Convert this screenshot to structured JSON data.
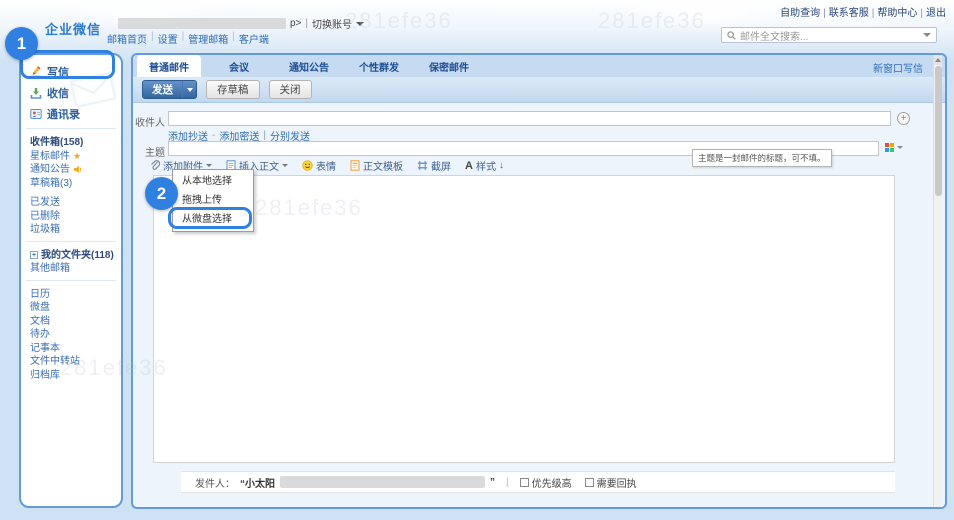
{
  "page": {
    "watermark": "281efe36"
  },
  "header": {
    "quick_links": [
      "自助查询",
      "联系客服",
      "帮助中心",
      "退出"
    ],
    "logo": "企业微信",
    "account": {
      "masked_suffix": "p>",
      "switch_label": "切换账号"
    },
    "nav_links": [
      "邮箱首页",
      "设置",
      "管理邮箱",
      "客户端"
    ],
    "search": {
      "placeholder": "邮件全文搜索..."
    }
  },
  "sidebar": {
    "actions": [
      {
        "label": "写信"
      },
      {
        "label": "收信"
      },
      {
        "label": "通讯录"
      }
    ],
    "folders": [
      {
        "label": "收件箱(158)"
      },
      {
        "label": "星标邮件"
      },
      {
        "label": "通知公告"
      },
      {
        "label": "草稿箱(3)"
      },
      {
        "label": "已发送"
      },
      {
        "label": "已删除"
      },
      {
        "label": "垃圾箱"
      }
    ],
    "my_folders": "我的文件夹(118)",
    "other_mailbox": "其他邮箱",
    "apps": [
      "日历",
      "微盘",
      "文档",
      "待办",
      "记事本",
      "文件中转站",
      "归档库"
    ]
  },
  "compose": {
    "new_window_link": "新窗口写信",
    "tabs": [
      {
        "label": "普通邮件"
      },
      {
        "label": "会议"
      },
      {
        "label": "通知公告"
      },
      {
        "label": "个性群发"
      },
      {
        "label": "保密邮件"
      }
    ],
    "actions": {
      "send": "发送",
      "save_draft": "存草稿",
      "close": "关闭"
    },
    "recipient": {
      "label": "收件人",
      "value": ""
    },
    "cc_row": {
      "add_cc": "添加抄送",
      "dash": "-",
      "add_bcc": "添加密送",
      "pipe": "|",
      "separate": "分别发送"
    },
    "subject": {
      "label": "主题",
      "value": "",
      "tooltip": "主题是一封邮件的标题，可不填。"
    },
    "editor_toolbar": [
      {
        "label": "添加附件"
      },
      {
        "label": "插入正文"
      },
      {
        "label": "表情"
      },
      {
        "label": "正文模板"
      },
      {
        "label": "截屏"
      },
      {
        "label": "样式",
        "suffix": "↓"
      }
    ],
    "attach_menu": {
      "items": [
        "从本地选择",
        "拖拽上传",
        "从微盘选择"
      ],
      "highlighted": "从微盘选择"
    },
    "footer": {
      "from_label": "发件人：",
      "from_name": "“小太阳",
      "close_quote": "”",
      "pipe": "|",
      "options": [
        {
          "label": "优先级高"
        },
        {
          "label": "需要回执"
        }
      ]
    }
  },
  "annotations": [
    {
      "number": "1",
      "target": "写信"
    },
    {
      "number": "2",
      "target": "从微盘选择"
    }
  ],
  "colors": {
    "annotation_blue": "#2f80e0",
    "panel_border": "#649bd6",
    "link_blue": "#2f6cb7",
    "send_button": "#33659f"
  }
}
